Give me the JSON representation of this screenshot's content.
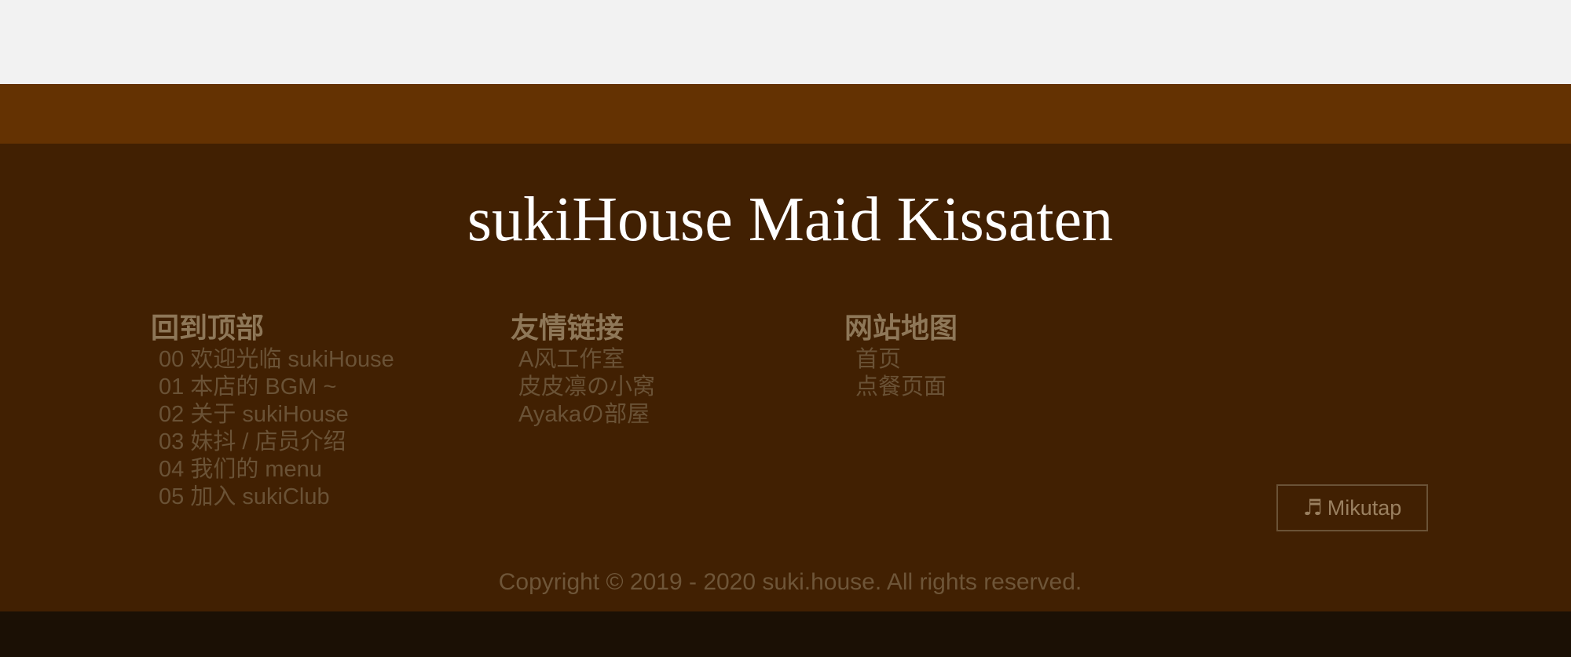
{
  "colors": {
    "top_background": "#f2f2f2",
    "orange_band": "#643202",
    "footer_background": "#412002",
    "bottom_strip": "#1b1005",
    "title_text": "#ffffff",
    "heading_text": "#8e7758",
    "link_text": "#6a5236"
  },
  "footer": {
    "title": "sukiHouse Maid Kissaten",
    "columns": [
      {
        "heading": "回到顶部",
        "links": [
          "00 欢迎光临 sukiHouse",
          "01 本店的 BGM ~",
          "02 关于 sukiHouse",
          "03 妹抖 / 店员介绍",
          "04 我们的 menu",
          "05 加入 sukiClub"
        ]
      },
      {
        "heading": "友情链接",
        "links": [
          "A风工作室",
          "皮皮凛の小窝",
          "Ayakaの部屋"
        ]
      },
      {
        "heading": "网站地图",
        "links": [
          "首页",
          "点餐页面"
        ]
      }
    ],
    "music_button": {
      "icon": "music-note-icon",
      "label": "Mikutap"
    },
    "copyright": "Copyright © 2019 - 2020 suki.house. All rights reserved."
  }
}
